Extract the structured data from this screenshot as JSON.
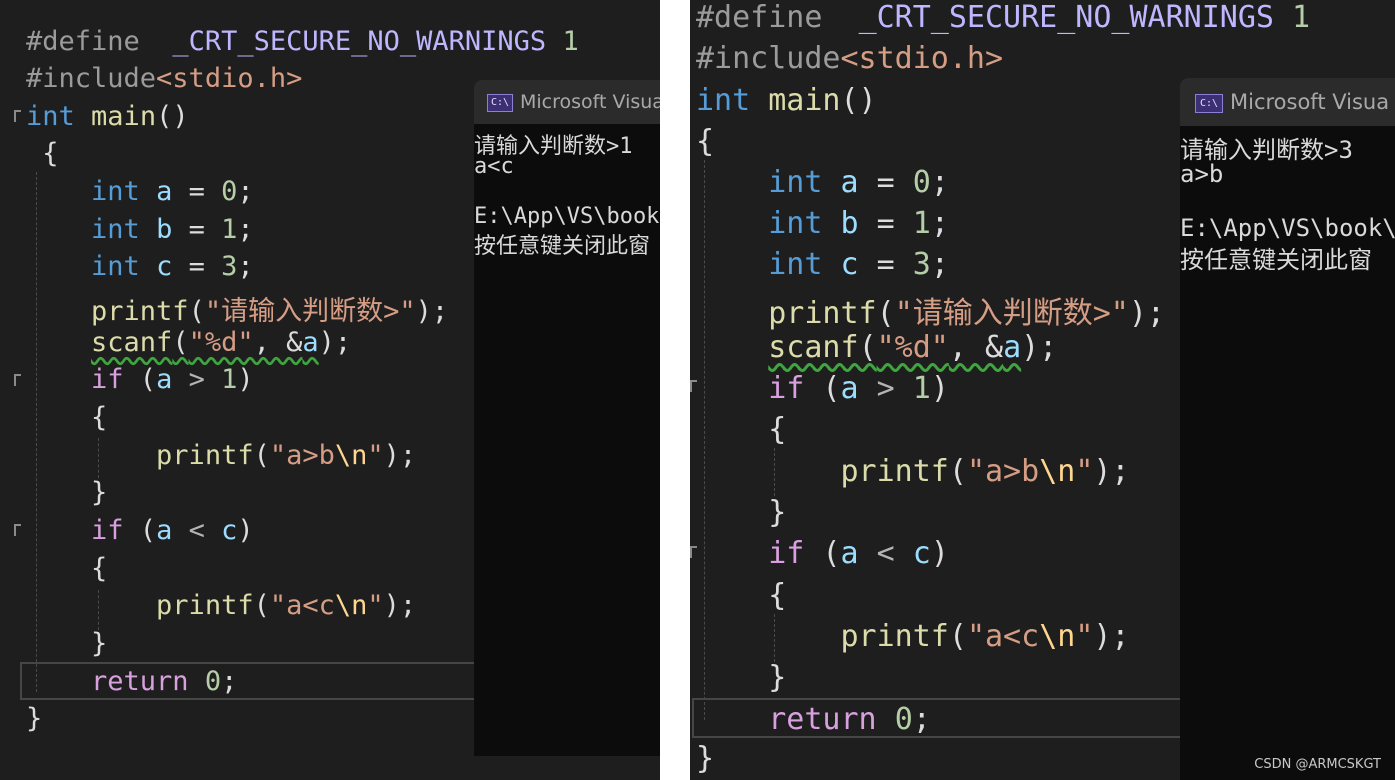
{
  "panels": [
    {
      "code": {
        "define_kw": "#define",
        "define_macro": "_CRT_SECURE_NO_WARNINGS",
        "define_val": "1",
        "include_kw": "#include",
        "include_file": "<stdio.h>",
        "main_kw": "int",
        "main_name": "main",
        "main_parens": "()",
        "brace_open": "{",
        "brace_close": "}",
        "decl_a_type": "int",
        "decl_a": "a",
        "decl_a_eq": " = ",
        "decl_a_val": "0",
        "decl_a_end": ";",
        "decl_b_type": "int",
        "decl_b": "b",
        "decl_b_eq": " = ",
        "decl_b_val": "1",
        "decl_b_end": ";",
        "decl_c_type": "int",
        "decl_c": "c",
        "decl_c_eq": " = ",
        "decl_c_val": "3",
        "decl_c_end": ";",
        "printf_fn": "printf",
        "printf_open": "(",
        "printf_str": "\"请输入判断数>\"",
        "printf_close": ");",
        "scanf_fn": "scanf",
        "scanf_open": "(",
        "scanf_str": "\"%d\"",
        "scanf_args": ", &",
        "scanf_var": "a",
        "scanf_close": ");",
        "if1_kw": "if",
        "if1_open": " (",
        "if1_var": "a",
        "if1_op": " > ",
        "if1_val": "1",
        "if1_close": ")",
        "if1_brace_open": "{",
        "if1_printf": "printf",
        "if1_po": "(",
        "if1_str": "\"a>b",
        "if1_esc": "\\n",
        "if1_str_end": "\"",
        "if1_pc": ");",
        "if1_brace_close": "}",
        "if2_kw": "if",
        "if2_open": " (",
        "if2_var": "a",
        "if2_op": " < ",
        "if2_var2": "c",
        "if2_close": ")",
        "if2_brace_open": "{",
        "if2_printf": "printf",
        "if2_po": "(",
        "if2_str": "\"a<c",
        "if2_esc": "\\n",
        "if2_str_end": "\"",
        "if2_pc": ");",
        "if2_brace_close": "}",
        "return_kw": "return",
        "return_val": "0",
        "return_end": ";"
      },
      "console": {
        "title": "Microsoft Visual",
        "icon_label": "C:\\",
        "lines": [
          "请输入判断数>1",
          "a<c",
          "",
          "E:\\App\\VS\\book\\",
          "按任意键关闭此窗"
        ]
      }
    },
    {
      "code": {
        "define_kw": "#define",
        "define_macro": "_CRT_SECURE_NO_WARNINGS",
        "define_val": "1",
        "include_kw": "#include",
        "include_file": "<stdio.h>",
        "main_kw": "int",
        "main_name": "main",
        "main_parens": "()",
        "brace_open": "{",
        "brace_close": "}",
        "decl_a_type": "int",
        "decl_a": "a",
        "decl_a_eq": " = ",
        "decl_a_val": "0",
        "decl_a_end": ";",
        "decl_b_type": "int",
        "decl_b": "b",
        "decl_b_eq": " = ",
        "decl_b_val": "1",
        "decl_b_end": ";",
        "decl_c_type": "int",
        "decl_c": "c",
        "decl_c_eq": " = ",
        "decl_c_val": "3",
        "decl_c_end": ";",
        "printf_fn": "printf",
        "printf_open": "(",
        "printf_str": "\"请输入判断数>\"",
        "printf_close": ");",
        "scanf_fn": "scanf",
        "scanf_open": "(",
        "scanf_str": "\"%d\"",
        "scanf_args": ", &",
        "scanf_var": "a",
        "scanf_close": ");",
        "if1_kw": "if",
        "if1_open": " (",
        "if1_var": "a",
        "if1_op": " > ",
        "if1_val": "1",
        "if1_close": ")",
        "if1_brace_open": "{",
        "if1_printf": "printf",
        "if1_po": "(",
        "if1_str": "\"a>b",
        "if1_esc": "\\n",
        "if1_str_end": "\"",
        "if1_pc": ");",
        "if1_brace_close": "}",
        "if2_kw": "if",
        "if2_open": " (",
        "if2_var": "a",
        "if2_op": " < ",
        "if2_var2": "c",
        "if2_close": ")",
        "if2_brace_open": "{",
        "if2_printf": "printf",
        "if2_po": "(",
        "if2_str": "\"a<c",
        "if2_esc": "\\n",
        "if2_str_end": "\"",
        "if2_pc": ");",
        "if2_brace_close": "}",
        "return_kw": "return",
        "return_val": "0",
        "return_end": ";"
      },
      "console": {
        "title": "Microsoft Visua",
        "icon_label": "C:\\",
        "lines": [
          "请输入判断数>3",
          "a>b",
          "",
          "E:\\App\\VS\\book\\",
          "按任意键关闭此窗"
        ]
      }
    }
  ],
  "watermark": "CSDN @ARMCSKGT",
  "colors": {
    "editor_bg": "#1e1e1e",
    "keyword": "#569cd6",
    "control": "#d8a0df",
    "function": "#dcdcaa",
    "string": "#d69d85",
    "number": "#b5cea8",
    "console_bg": "#0c0c0c"
  }
}
